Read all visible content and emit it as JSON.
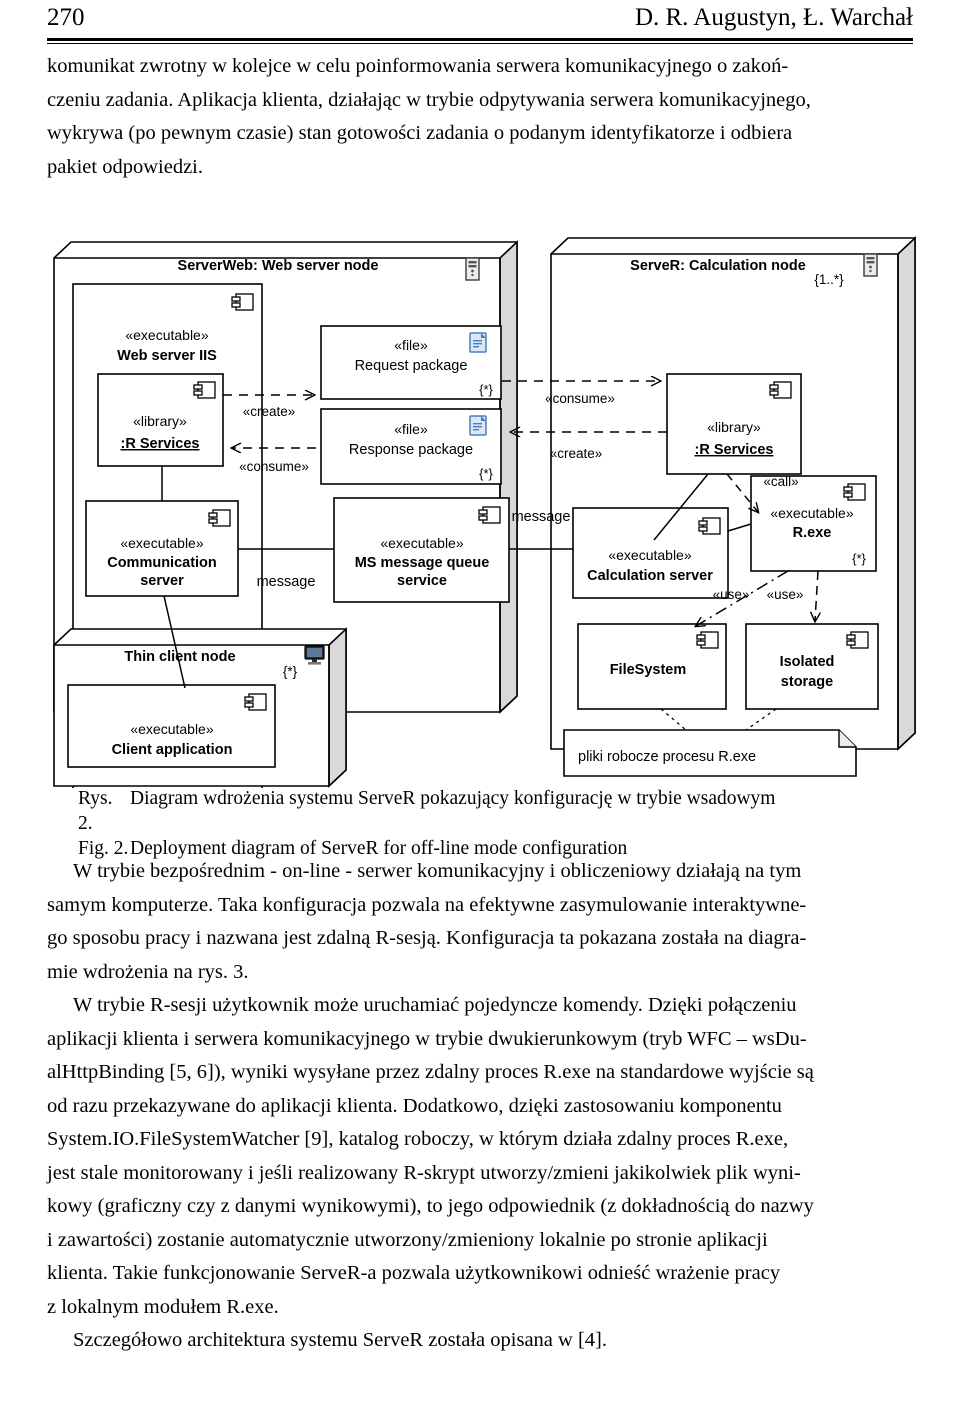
{
  "running_head": {
    "page_number": "270",
    "authors": "D. R. Augustyn, Ł. Warchał"
  },
  "paragraph_above": {
    "line1": "komunikat zwrotny w kolejce w celu poinformowania serwera komunikacyjnego o zakoń-",
    "line2": "czeniu zadania. Aplikacja klienta, działając w trybie odpytywania serwera komunikacyjnego,",
    "line3": "wykrywa (po pewnym czasie) stan gotowości zadania o podanym identyfikatorze i odbiera",
    "line4": "pakiet odpowiedzi."
  },
  "figure": {
    "caption_pl_label": "Rys. 2.",
    "caption_pl_text": "Diagram wdrożenia systemu ServeR pokazujący konfigurację w trybie wsadowym",
    "caption_en_label": "Fig. 2.",
    "caption_en_text": "Deployment diagram of ServeR for off-line mode configuration",
    "nodes": {
      "server_web": {
        "title": "ServerWeb: Web server node",
        "icon": "server-tower-icon"
      },
      "server_r": {
        "title": "ServeR: Calculation node",
        "multiplicity": "{1..*}",
        "icon": "server-tower-icon"
      },
      "thin_client": {
        "title": "Thin client node",
        "multiplicity": "{*}",
        "icon": "monitor-icon"
      }
    },
    "components": {
      "web_server_iis": {
        "stereotype": "«executable»",
        "name": "Web server IIS"
      },
      "r_services_web": {
        "stereotype": "«library»",
        "name": ":R Services"
      },
      "communication_server": {
        "stereotype": "«executable»",
        "name_line1": "Communication",
        "name_line2": "server"
      },
      "ms_message_queue": {
        "stereotype": "«executable»",
        "name_line1": "MS message queue",
        "name_line2": "service"
      },
      "request_package": {
        "stereotype": "«file»",
        "name": "Request package",
        "multiplicity": "{*}",
        "icon": "document-icon"
      },
      "response_package": {
        "stereotype": "«file»",
        "name": "Response package",
        "multiplicity": "{*}",
        "icon": "document-icon"
      },
      "r_services_calc": {
        "stereotype": "«library»",
        "name": ":R Services"
      },
      "calculation_server": {
        "stereotype": "«executable»",
        "name": "Calculation server"
      },
      "r_exe": {
        "stereotype": "«executable»",
        "name": "R.exe",
        "multiplicity": "{*}"
      },
      "file_system": {
        "name": "FileSystem"
      },
      "isolated_storage": {
        "name_line1": "Isolated",
        "name_line2": "storage"
      },
      "client_application": {
        "stereotype": "«executable»",
        "name": "Client application"
      }
    },
    "edge_labels": {
      "create_web": "«create»",
      "consume_web": "«consume»",
      "consume_calc": "«consume»",
      "create_calc": "«create»",
      "call": "«call»",
      "use_fs": "«use»",
      "use_iso": "«use»",
      "message_left": "message",
      "message_right": "message"
    },
    "note": {
      "text": "pliki  robocze procesu R.exe"
    }
  },
  "paragraph_below": {
    "line1": "W trybie bezpośrednim - on-line - serwer komunikacyjny i obliczeniowy działają na tym",
    "line2": "samym komputerze. Taka konfiguracja pozwala na efektywne zasymulowanie interaktywne-",
    "line3": "go sposobu pracy i nazwana jest zdalną R-sesją. Konfiguracja ta pokazana została na diagra-",
    "line4": "mie wdrożenia na rys. 3.",
    "line5": "W trybie R-sesji użytkownik może uruchamiać pojedyncze komendy. Dzięki połączeniu",
    "line6": "aplikacji klienta i serwera komunikacyjnego w trybie dwukierunkowym (tryb WFC – wsDu-",
    "line7": "alHttpBinding [5, 6]), wyniki wysyłane przez zdalny proces R.exe na standardowe wyjście są",
    "line8": "od razu przekazywane do aplikacji klienta. Dodatkowo, dzięki zastosowaniu komponentu",
    "line9": "System.IO.FileSystemWatcher [9], katalog roboczy, w którym działa zdalny proces R.exe,",
    "line10": "jest stale monitorowany i jeśli realizowany R-skrypt utworzy/zmieni jakikolwiek plik wyni-",
    "line11": "kowy (graficzny czy z danymi wynikowymi), to jego odpowiednik (z dokładnością do nazwy",
    "line12": "i zawartości) zostanie automatycznie utworzony/zmieniony lokalnie po stronie aplikacji",
    "line13": "klienta. Takie funkcjonowanie ServeR-a pozwala użytkownikowi odnieść wrażenie pracy",
    "line14": "z lokalnym modułem R.exe.",
    "line15": "Szczegółowo architektura systemu ServeR została opisana w [4]."
  },
  "colors": {
    "ink": "#000000",
    "paper": "#ffffff",
    "node_shade": "#d9d9d9",
    "doc_icon_blue": "#4a7ebb"
  }
}
